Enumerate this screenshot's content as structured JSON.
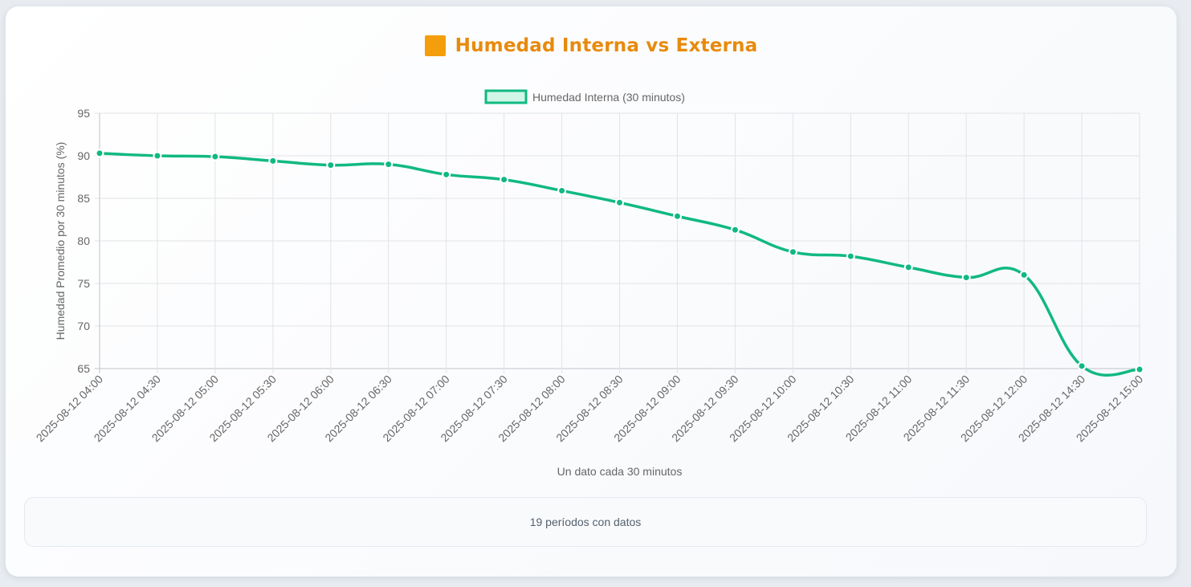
{
  "header": {
    "title": "Humedad Interna vs Externa",
    "icon_name": "orange-square-icon",
    "icon_color": "#f59e0b",
    "title_color": "#e88a0c"
  },
  "chart_data": {
    "type": "line",
    "x": [
      "2025-08-12 04:00",
      "2025-08-12 04:30",
      "2025-08-12 05:00",
      "2025-08-12 05:30",
      "2025-08-12 06:00",
      "2025-08-12 06:30",
      "2025-08-12 07:00",
      "2025-08-12 07:30",
      "2025-08-12 08:00",
      "2025-08-12 08:30",
      "2025-08-12 09:00",
      "2025-08-12 09:30",
      "2025-08-12 10:00",
      "2025-08-12 10:30",
      "2025-08-12 11:00",
      "2025-08-12 11:30",
      "2025-08-12 12:00",
      "2025-08-12 14:30",
      "2025-08-12 15:00"
    ],
    "series": [
      {
        "name": "Humedad Interna (30 minutos)",
        "color": "#10b981",
        "values": [
          90.3,
          90.0,
          89.9,
          89.4,
          88.9,
          89.0,
          87.8,
          87.2,
          85.9,
          84.5,
          82.9,
          81.3,
          78.7,
          78.2,
          76.9,
          75.7,
          76.0,
          65.3,
          64.9
        ]
      }
    ],
    "title": "",
    "xlabel": "Un dato cada 30 minutos",
    "ylabel": "Humedad Promedio por 30 minutos (%)",
    "ylim": [
      65,
      95
    ],
    "yticks": [
      65,
      70,
      75,
      80,
      85,
      90,
      95
    ],
    "grid": true,
    "legend": "top-center"
  },
  "footer": {
    "summary": "19 períodos con datos"
  }
}
